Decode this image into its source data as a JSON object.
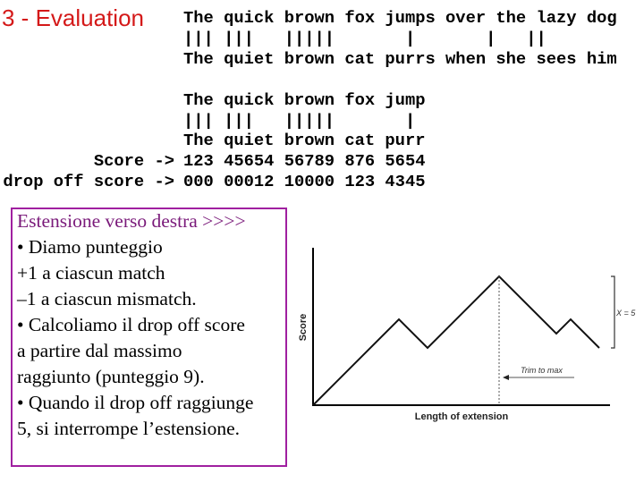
{
  "slide": {
    "title": "3 - Evaluation",
    "alignment1": [
      "The quick brown fox jumps over the lazy dog",
      "||| |||   |||||       |       |   ||",
      "The quiet brown cat purrs when she sees him"
    ],
    "alignment2": [
      "The quick brown fox jump",
      "||| |||   |||||       |",
      "The quiet brown cat purr",
      "123 45654 56789 876 5654",
      "000 00012 10000 123 4345"
    ],
    "score_label": "Score ->",
    "dropoff_label": "drop off score ->",
    "box": {
      "heading": "Estensione verso destra >>>>",
      "lines": [
        "• Diamo punteggio",
        "+1  a ciascun match",
        "–1 a ciascun mismatch.",
        "• Calcoliamo il drop off score",
        "a partire dal massimo",
        "raggiunto (punteggio 9).",
        "• Quando il drop off raggiunge",
        "5, si interrompe l’estensione."
      ],
      "border_color": "#a020a0"
    },
    "title_color": "#d41919"
  },
  "chart_data": {
    "type": "line",
    "xlabel": "Length of extension",
    "ylabel": "Score",
    "annotations": [
      "Trim to max",
      "X = 5"
    ],
    "points": [
      [
        0,
        0
      ],
      [
        6,
        6
      ],
      [
        8,
        4
      ],
      [
        13,
        9
      ],
      [
        17,
        5
      ],
      [
        18,
        6
      ],
      [
        20,
        4
      ]
    ],
    "max_point": [
      13,
      9
    ],
    "drop_off_threshold": 5,
    "grid": false
  }
}
